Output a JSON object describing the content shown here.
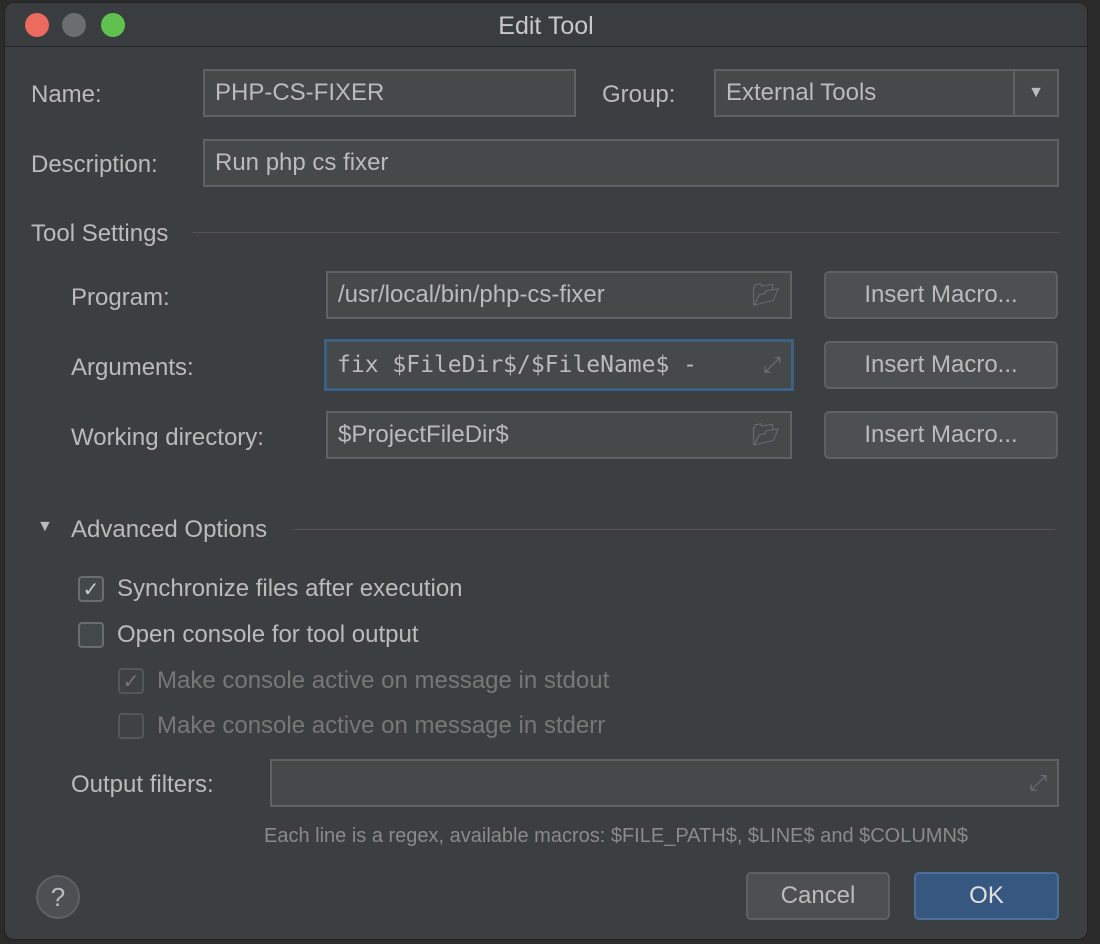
{
  "window": {
    "title": "Edit Tool"
  },
  "name": {
    "label": "Name:",
    "value": "PHP-CS-FIXER"
  },
  "group": {
    "label": "Group:",
    "value": "External Tools"
  },
  "description": {
    "label": "Description:",
    "value": "Run php cs fixer"
  },
  "tool_settings": {
    "title": "Tool Settings",
    "program": {
      "label": "Program:",
      "value": "/usr/local/bin/php-cs-fixer"
    },
    "arguments": {
      "label": "Arguments:",
      "value": "fix $FileDir$/$FileName$ -"
    },
    "working_directory": {
      "label": "Working directory:",
      "value": "$ProjectFileDir$"
    },
    "insert_macro": "Insert Macro..."
  },
  "advanced": {
    "title": "Advanced Options",
    "sync": {
      "label": "Synchronize files after execution",
      "checked": true
    },
    "console": {
      "label": "Open console for tool output",
      "checked": false
    },
    "stdout": {
      "label": "Make console active on message in stdout",
      "checked": true,
      "disabled": true
    },
    "stderr": {
      "label": "Make console active on message in stderr",
      "checked": false,
      "disabled": true
    },
    "output_filters": {
      "label": "Output filters:",
      "value": ""
    },
    "hint": "Each line is a regex, available macros: $FILE_PATH$, $LINE$ and $COLUMN$"
  },
  "footer": {
    "help": "?",
    "cancel": "Cancel",
    "ok": "OK"
  },
  "colors": {
    "accent": "#365880",
    "focus": "#3d6185"
  }
}
